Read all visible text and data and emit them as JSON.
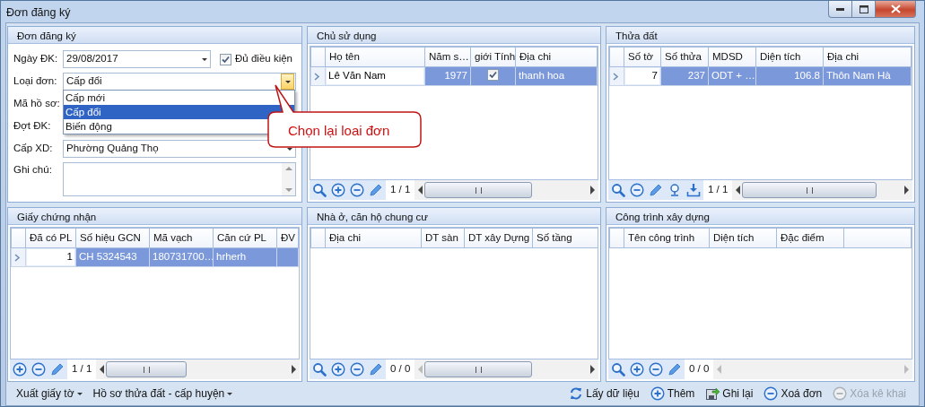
{
  "window": {
    "title": "Đơn đăng ký"
  },
  "form": {
    "title": "Đơn đăng ký",
    "date": {
      "label": "Ngày ĐK:",
      "value": "29/08/2017"
    },
    "eligible": {
      "label": "Đủ điều kiện",
      "checked": true
    },
    "type": {
      "label": "Loại đơn:",
      "value": "Cấp đổi",
      "expanded": true,
      "options": [
        {
          "label": "Cấp mới",
          "selected": false
        },
        {
          "label": "Cấp đổi",
          "selected": true
        },
        {
          "label": "Biến động",
          "selected": false
        }
      ]
    },
    "file_no": {
      "label": "Mã hồ sơ:"
    },
    "batch": {
      "label": "Đợt ĐK:"
    },
    "level": {
      "label": "Cấp XD:",
      "value": "Phường Quảng Thọ"
    },
    "note": {
      "label": "Ghi chú:"
    }
  },
  "callout": {
    "text": "Chọn lại loai đơn"
  },
  "grids": [
    {
      "title": "Chủ sử dụng",
      "columns": [
        {
          "label": "Họ tên"
        },
        {
          "label": "Năm s…"
        },
        {
          "label": "giới Tính"
        },
        {
          "label": "Địa chi"
        }
      ],
      "rows": [
        {
          "selected": true,
          "cells": [
            {
              "kind": "text",
              "text": "Lê Văn Nam",
              "focused": true
            },
            {
              "kind": "number",
              "text": "1977",
              "focused": false
            },
            {
              "kind": "check",
              "checked": true,
              "focused": false
            },
            {
              "kind": "text",
              "text": "thanh hoa",
              "focused": false
            }
          ]
        }
      ],
      "tools": [
        {
          "kind": "search"
        },
        {
          "kind": "add"
        },
        {
          "kind": "remove"
        },
        {
          "kind": "edit"
        }
      ],
      "pager": "1 / 1"
    },
    {
      "title": "Thửa đất",
      "columns": [
        {
          "label": "Số tờ"
        },
        {
          "label": "Số thửa"
        },
        {
          "label": "MDSD"
        },
        {
          "label": "Diện tích"
        },
        {
          "label": "Địa chi"
        }
      ],
      "rows": [
        {
          "selected": true,
          "cells": [
            {
              "kind": "number",
              "text": "7",
              "focused": true
            },
            {
              "kind": "number",
              "text": "237",
              "focused": false
            },
            {
              "kind": "text",
              "text": "ODT + …",
              "focused": false
            },
            {
              "kind": "number",
              "text": "106.8",
              "focused": false
            },
            {
              "kind": "text",
              "text": "Thôn Nam Hà",
              "focused": false
            }
          ]
        }
      ],
      "tools": [
        {
          "kind": "search"
        },
        {
          "kind": "remove"
        },
        {
          "kind": "edit"
        },
        {
          "kind": "pin"
        },
        {
          "kind": "download"
        }
      ],
      "pager": "1 / 1"
    },
    {
      "title": "Giấy chứng nhận",
      "columns": [
        {
          "label": "Đã có PL"
        },
        {
          "label": "Số hiệu GCN"
        },
        {
          "label": "Mã vạch"
        },
        {
          "label": "Căn cứ PL"
        },
        {
          "label": "ĐV"
        }
      ],
      "rows": [
        {
          "selected": true,
          "cells": [
            {
              "kind": "number",
              "text": "1",
              "focused": true
            },
            {
              "kind": "text",
              "text": "CH 5324543",
              "focused": false
            },
            {
              "kind": "text",
              "text": "180731700…",
              "focused": false
            },
            {
              "kind": "text",
              "text": "hrherh",
              "focused": false
            },
            {
              "kind": "text",
              "focused": false
            }
          ]
        }
      ],
      "tools": [
        {
          "kind": "add"
        },
        {
          "kind": "remove"
        },
        {
          "kind": "edit"
        }
      ],
      "pager": "1 / 1"
    },
    {
      "title": "Nhà ở, căn hộ chung cư",
      "columns": [
        {
          "label": "Địa chi"
        },
        {
          "label": "DT sàn"
        },
        {
          "label": "DT xây Dựng"
        },
        {
          "label": "Số tầng"
        }
      ],
      "tools": [
        {
          "kind": "search"
        },
        {
          "kind": "add"
        },
        {
          "kind": "remove"
        },
        {
          "kind": "edit"
        }
      ],
      "pager": "0 / 0"
    },
    {
      "title": "Công trình xây dựng",
      "columns": [
        {
          "label": "Tên công trình"
        },
        {
          "label": "Diện tích"
        },
        {
          "label": "Đặc điểm"
        }
      ],
      "tools": [
        {
          "kind": "search"
        },
        {
          "kind": "add"
        },
        {
          "kind": "remove"
        },
        {
          "kind": "edit"
        }
      ],
      "pager": "0 / 0"
    }
  ],
  "footer": {
    "menus": [
      {
        "label": "Xuất giấy tờ"
      },
      {
        "label": "Hồ sơ thửa đất - cấp huyện"
      }
    ],
    "actions": [
      {
        "kind": "refresh",
        "label": "Lấy dữ liệu",
        "disabled": false
      },
      {
        "kind": "add",
        "label": "Thêm",
        "disabled": false
      },
      {
        "kind": "save",
        "label": "Ghi lại",
        "disabled": false
      },
      {
        "kind": "remove",
        "label": "Xoá đơn",
        "disabled": false
      },
      {
        "kind": "remove",
        "label": "Xóa kê khai",
        "disabled": true
      }
    ]
  }
}
